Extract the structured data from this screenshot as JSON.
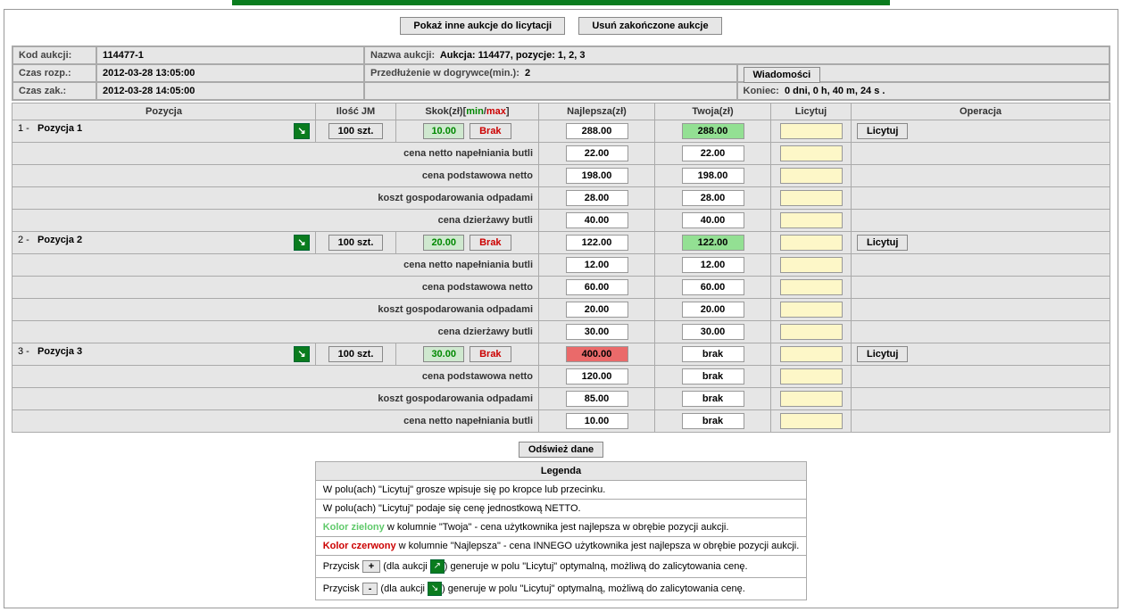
{
  "topbar": {
    "btn_show_other": "Pokaż inne aukcje do licytacji",
    "btn_remove_finished": "Usuń zakończone aukcje"
  },
  "info": {
    "kod_label": "Kod aukcji:",
    "kod_value": "114477-1",
    "nazwa_label": "Nazwa aukcji:",
    "nazwa_value": "Aukcja: 114477, pozycje: 1, 2, 3",
    "rozp_label": "Czas rozp.:",
    "rozp_value": "2012-03-28 13:05:00",
    "przedl_label": "Przedłużenie w dogrywce(min.):",
    "przedl_value": "2",
    "wiad_btn": "Wiadomości",
    "zak_label": "Czas zak.:",
    "zak_value": "2012-03-28 14:05:00",
    "koniec_label": "Koniec:",
    "koniec_value": "0 dni, 0 h, 40 m, 24 s ."
  },
  "headers": {
    "pozycja": "Pozycja",
    "ilosc": "Ilość JM",
    "skok_pre": "Skok(zł)[",
    "skok_min": "min",
    "skok_sep": "/",
    "skok_max": "max",
    "skok_post": "]",
    "najlepsza": "Najlepsza(zł)",
    "twoja": "Twoja(zł)",
    "licytuj": "Licytuj",
    "operacja": "Operacja"
  },
  "common": {
    "brak": "Brak",
    "brak_l": "brak",
    "licytuj_btn": "Licytuj",
    "odswiez": "Odśwież dane"
  },
  "rows": {
    "p1": {
      "idx": "1 -",
      "name": "Pozycja 1",
      "ilosc": "100 szt.",
      "skok": "10.00",
      "best": "288.00",
      "your": "288.00",
      "sub": [
        {
          "label": "cena netto napełniania butli",
          "best": "22.00",
          "your": "22.00"
        },
        {
          "label": "cena podstawowa netto",
          "best": "198.00",
          "your": "198.00"
        },
        {
          "label": "koszt gospodarowania odpadami",
          "best": "28.00",
          "your": "28.00"
        },
        {
          "label": "cena dzierżawy butli",
          "best": "40.00",
          "your": "40.00"
        }
      ]
    },
    "p2": {
      "idx": "2 -",
      "name": "Pozycja 2",
      "ilosc": "100 szt.",
      "skok": "20.00",
      "best": "122.00",
      "your": "122.00",
      "sub": [
        {
          "label": "cena netto napełniania butli",
          "best": "12.00",
          "your": "12.00"
        },
        {
          "label": "cena podstawowa netto",
          "best": "60.00",
          "your": "60.00"
        },
        {
          "label": "koszt gospodarowania odpadami",
          "best": "20.00",
          "your": "20.00"
        },
        {
          "label": "cena dzierżawy butli",
          "best": "30.00",
          "your": "30.00"
        }
      ]
    },
    "p3": {
      "idx": "3 -",
      "name": "Pozycja 3",
      "ilosc": "100 szt.",
      "skok": "30.00",
      "best": "400.00",
      "your": "brak",
      "sub": [
        {
          "label": "cena podstawowa netto",
          "best": "120.00",
          "your": "brak"
        },
        {
          "label": "koszt gospodarowania odpadami",
          "best": "85.00",
          "your": "brak"
        },
        {
          "label": "cena netto napełniania butli",
          "best": "10.00",
          "your": "brak"
        }
      ]
    }
  },
  "legend": {
    "title": "Legenda",
    "l1": "W polu(ach) \"Licytuj\" grosze wpisuje się po kropce lub przecinku.",
    "l2": "W polu(ach) \"Licytuj\" podaje się cenę jednostkową NETTO.",
    "l3_pre": "Kolor zielony",
    "l3_post": " w kolumnie \"Twoja\" - cena użytkownika jest najlepsza w obrębie pozycji aukcji.",
    "l4_pre": "Kolor czerwony",
    "l4_post": " w kolumnie \"Najlepsza\" - cena INNEGO użytkownika jest najlepsza w obrębie pozycji aukcji.",
    "l5_p1": "Przycisk ",
    "l5_btn": "+",
    "l5_p2": " (dla aukcji ",
    "l5_p3": ") generuje w polu \"Licytuj\" optymalną, możliwą do zalicytowania cenę.",
    "l6_btn": "-"
  }
}
